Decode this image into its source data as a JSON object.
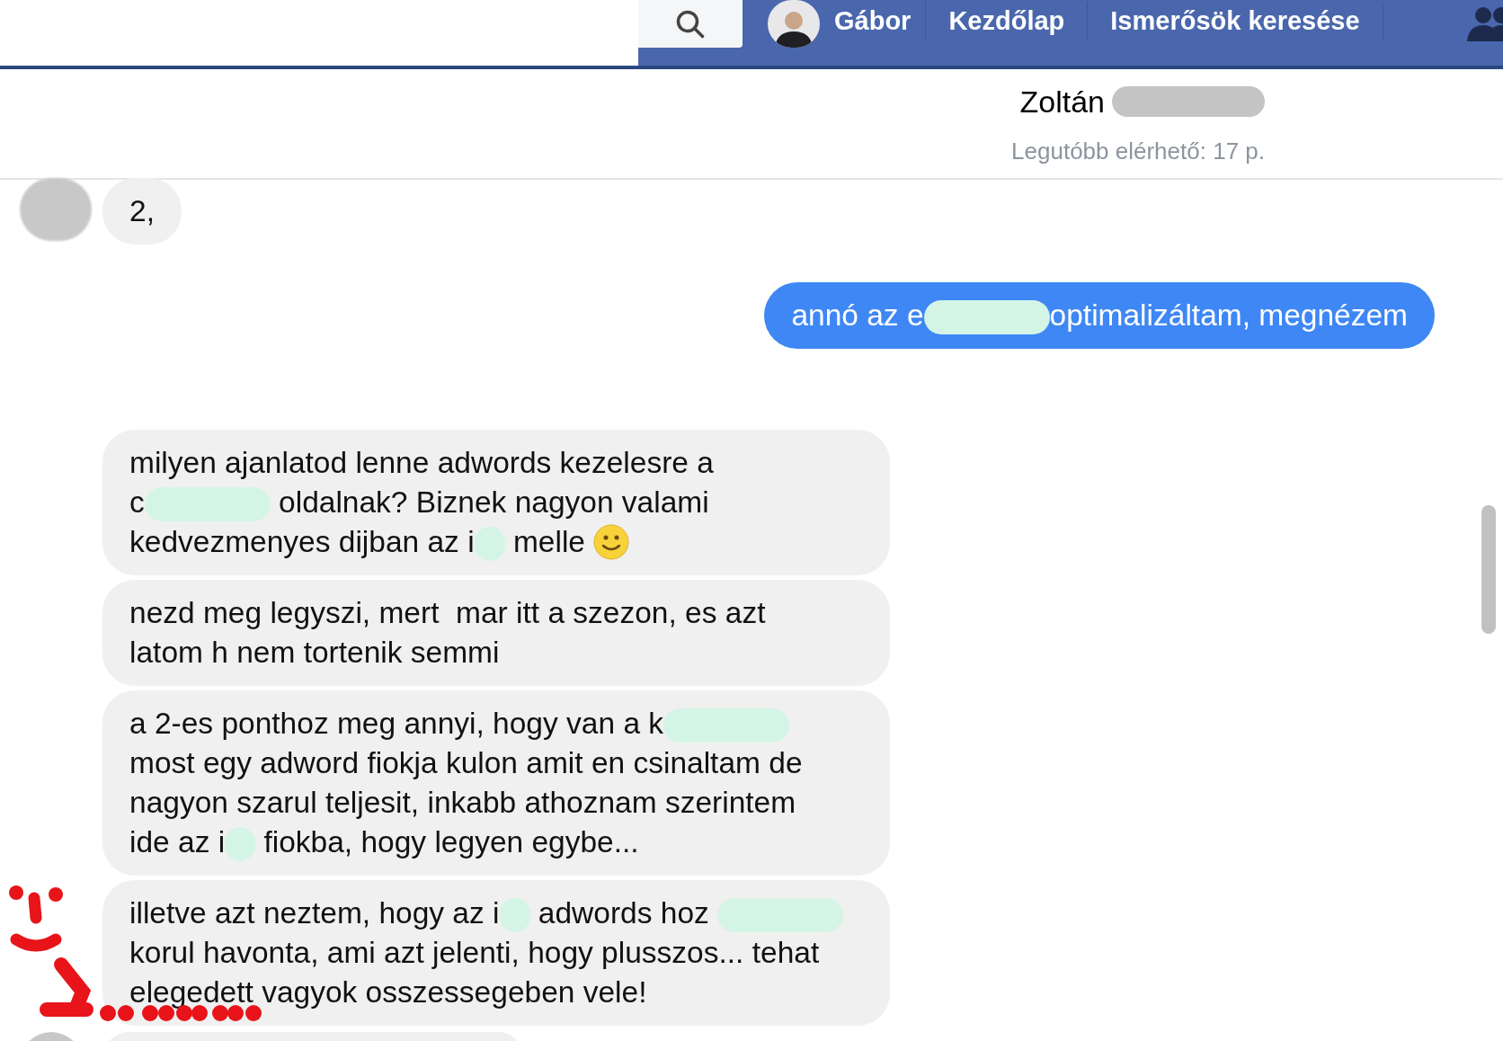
{
  "top_bar": {
    "user_name": "Gábor",
    "links": [
      {
        "label": "Kezdőlap"
      },
      {
        "label": "Ismerősök keresése"
      }
    ]
  },
  "chat_header": {
    "name": "Zoltán",
    "name_redacted": true,
    "status": "Legutóbb elérhető: 17 p."
  },
  "groups": [
    {
      "kind": "incoming",
      "messages": [
        {
          "lines": [
            [
              {
                "kind": "text",
                "text": "2,"
              }
            ]
          ]
        }
      ]
    },
    {
      "kind": "outgoing",
      "messages": [
        {
          "lines": [
            [
              {
                "kind": "text",
                "text": "annó az e"
              },
              {
                "kind": "smear",
                "color": "#d4f5e6"
              },
              {
                "kind": "text",
                "text": "optimalizáltam, megnézem"
              }
            ]
          ]
        }
      ]
    },
    {
      "kind": "incoming",
      "messages": [
        {
          "lines": [
            [
              {
                "kind": "text",
                "text": "milyen ajanlatod lenne adwords kezelesre a"
              }
            ],
            [
              {
                "kind": "text",
                "text": "c"
              },
              {
                "kind": "smear",
                "color": "#d4f5e6"
              },
              {
                "kind": "text",
                "text": " oldalnak? Biznek nagyon valami"
              }
            ],
            [
              {
                "kind": "text",
                "text": "kedvezmenyes dijban az i"
              },
              {
                "kind": "blot",
                "color": "#d4f5e6"
              },
              {
                "kind": "text",
                "text": " melle "
              },
              {
                "kind": "emoji"
              }
            ]
          ]
        },
        {
          "lines": [
            [
              {
                "kind": "text",
                "text": "nezd meg legyszi, mert  mar itt a szezon, es azt"
              }
            ],
            [
              {
                "kind": "text",
                "text": "latom h nem tortenik semmi"
              }
            ]
          ]
        },
        {
          "lines": [
            [
              {
                "kind": "text",
                "text": "a 2-es ponthoz meg annyi, hogy van a k"
              },
              {
                "kind": "smear",
                "color": "#d4f5e6"
              }
            ],
            [
              {
                "kind": "text",
                "text": "most egy adword fiokja kulon amit en csinaltam de"
              }
            ],
            [
              {
                "kind": "text",
                "text": "nagyon szarul teljesit, inkabb athoznam szerintem"
              }
            ],
            [
              {
                "kind": "text",
                "text": "ide az i"
              },
              {
                "kind": "blot",
                "color": "#d4f5e6"
              },
              {
                "kind": "text",
                "text": " fiokba, hogy legyen egybe..."
              }
            ]
          ]
        },
        {
          "lines": [
            [
              {
                "kind": "text",
                "text": "illetve azt neztem, hogy az i"
              },
              {
                "kind": "blot",
                "color": "#d4f5e6"
              },
              {
                "kind": "text",
                "text": " adwords hoz "
              },
              {
                "kind": "smear",
                "color": "#d4f5e6"
              }
            ],
            [
              {
                "kind": "text",
                "text": "korul havonta, ami azt jelenti, hogy plusszos... tehat"
              }
            ],
            [
              {
                "kind": "text",
                "text": "elegedett vagyok osszessegeben vele!"
              }
            ]
          ]
        }
      ]
    },
    {
      "kind": "stub"
    }
  ]
}
